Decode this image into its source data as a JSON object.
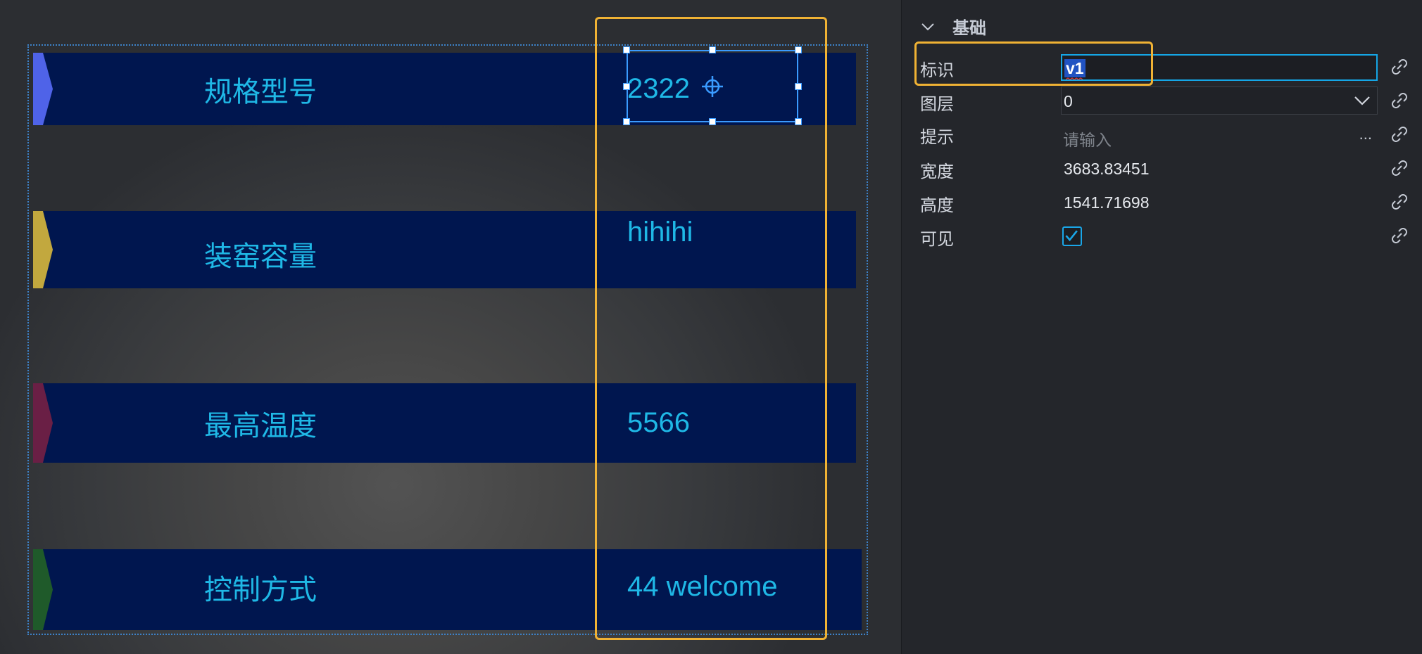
{
  "canvas": {
    "rows": [
      {
        "label": "规格型号",
        "value": "2322",
        "marker_color": "#4f63e8"
      },
      {
        "label": "装窑容量",
        "value": "hihihi",
        "marker_color": "#c2a83e"
      },
      {
        "label": "最高温度",
        "value": "5566",
        "marker_color": "#6a1f45"
      },
      {
        "label": "控制方式",
        "value": "44 welcome",
        "marker_color": "#1f5a2a"
      }
    ]
  },
  "panel": {
    "section_title": "基础",
    "props": {
      "id_label": "标识",
      "id_value": "v1",
      "layer_label": "图层",
      "layer_value": "0",
      "hint_label": "提示",
      "hint_placeholder": "请输入",
      "hint_more": "...",
      "width_label": "宽度",
      "width_value": "3683.83451",
      "height_label": "高度",
      "height_value": "1541.71698",
      "visible_label": "可见",
      "visible_checked": true
    }
  },
  "colors": {
    "row_bg": "#00164f",
    "text_cyan": "#1fb8e6",
    "highlight_orange": "#f0b234",
    "selection_blue": "#3a9bff"
  }
}
